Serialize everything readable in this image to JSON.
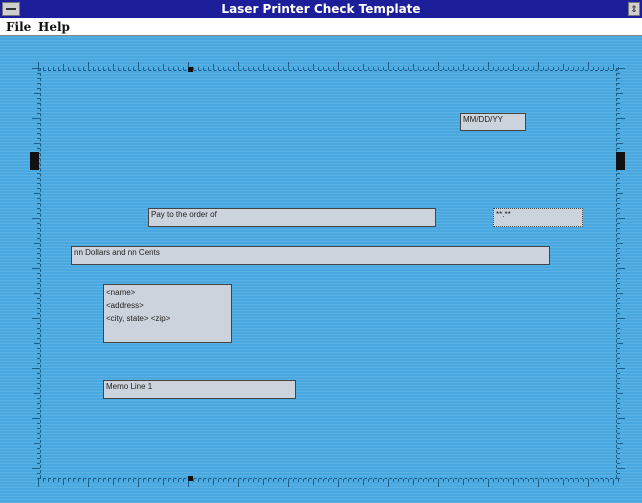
{
  "window": {
    "title": "Laser Printer Check Template",
    "max_icon": "restore-icon"
  },
  "menu": {
    "file": "File",
    "help": "Help"
  },
  "fields": {
    "date": "MM/DD/YY",
    "payee_label": "Pay to the order of",
    "amount": "**.**",
    "amount_text": "nn Dollars and nn Cents",
    "address": [
      "<name>",
      "<address>",
      "<city, state> <zip>"
    ],
    "memo": "Memo Line 1"
  },
  "colors": {
    "workspace": "#4aa8e0",
    "field": "#cdd3dc",
    "titlebar": "#1d1f9a"
  }
}
